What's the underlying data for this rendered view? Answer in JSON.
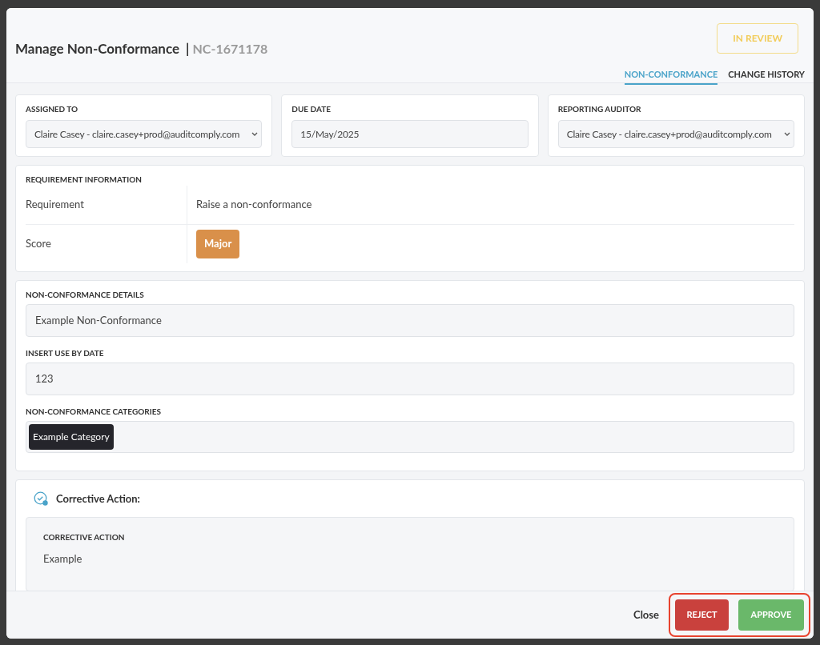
{
  "header": {
    "title": "Manage Non-Conformance",
    "separator": "|",
    "reference": "NC-1671178",
    "status": "IN REVIEW"
  },
  "tabs": [
    {
      "label": "NON-CONFORMANCE",
      "selected": true
    },
    {
      "label": "CHANGE HISTORY",
      "selected": false
    }
  ],
  "top_fields": [
    {
      "label": "ASSIGNED TO",
      "value": "Claire Casey - claire.casey+prod@auditcomply.com",
      "kind": "select"
    },
    {
      "label": "DUE DATE",
      "value": "15/May/2025",
      "kind": "date"
    },
    {
      "label": "REPORTING AUDITOR",
      "value": "Claire Casey - claire.casey+prod@auditcomply.com",
      "kind": "select"
    }
  ],
  "requirement_information": {
    "title": "REQUIREMENT INFORMATION",
    "rows": [
      {
        "label": "Requirement",
        "value": "Raise a non-conformance",
        "kind": "text"
      },
      {
        "label": "Score",
        "value": "Major",
        "kind": "badge",
        "color": "#d9904a"
      }
    ]
  },
  "details": [
    {
      "label": "NON-CONFORMANCE DETAILS",
      "value": "Example Non-Conformance",
      "kind": "text"
    },
    {
      "label": "INSERT USE BY DATE",
      "value": "123",
      "kind": "text"
    },
    {
      "label": "NON-CONFORMANCE CATEGORIES",
      "tags": [
        "Example Category"
      ],
      "kind": "tags"
    }
  ],
  "corrective_action": {
    "heading": "Corrective Action:",
    "label": "CORRECTIVE ACTION",
    "value": "Example"
  },
  "footer": {
    "close": "Close",
    "reject": "REJECT",
    "approve": "APPROVE",
    "highlighted": true
  }
}
